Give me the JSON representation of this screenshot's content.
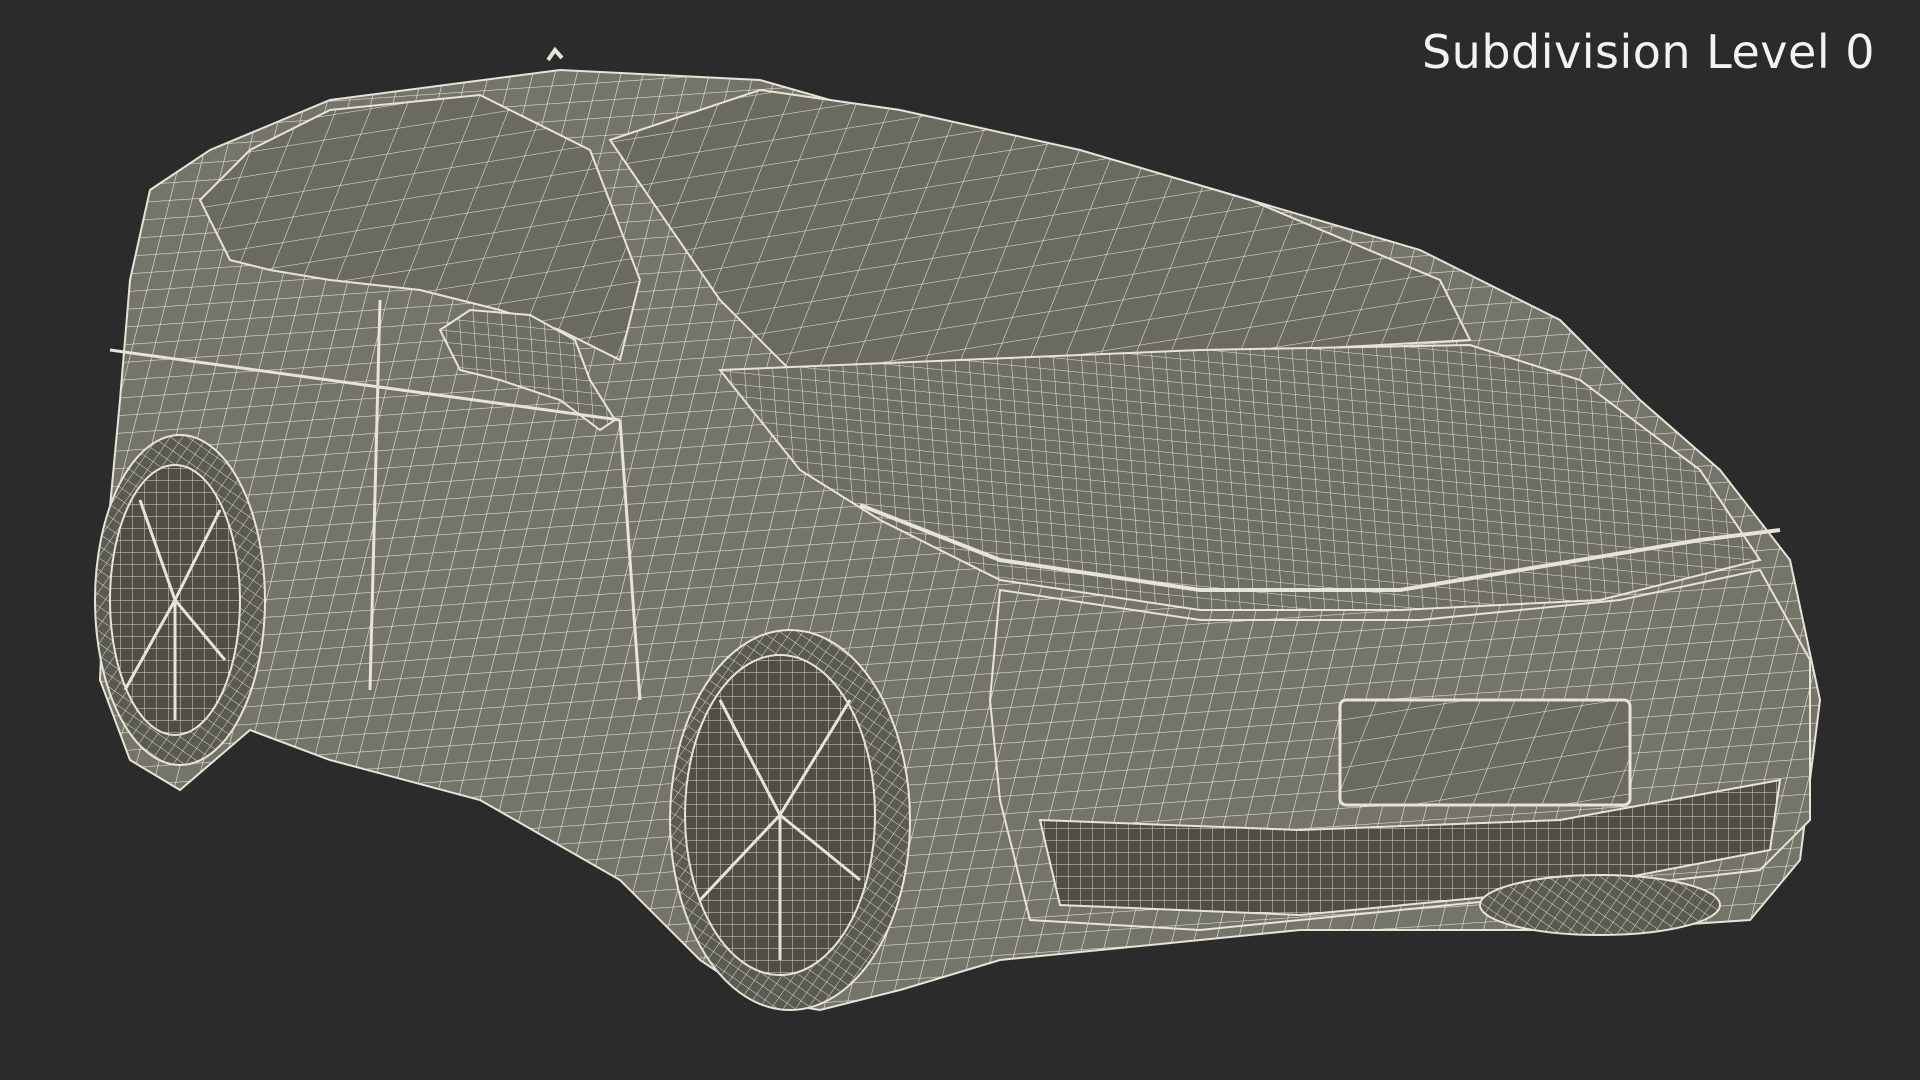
{
  "overlay": {
    "subdivision_label": "Subdivision Level 0"
  },
  "colors": {
    "background": "#2b2b2b",
    "surface": "#74746a",
    "surface_dark": "#55554d",
    "wire": "#e6e4d6"
  },
  "scene": {
    "subject": "car-wireframe-model"
  }
}
